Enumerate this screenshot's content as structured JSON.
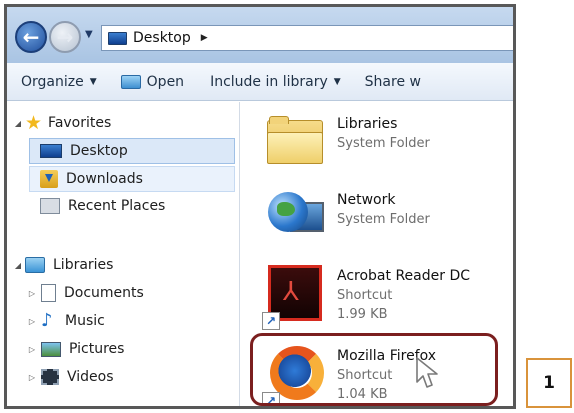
{
  "address_bar": {
    "location": "Desktop"
  },
  "toolbar": {
    "organize": "Organize",
    "open": "Open",
    "include_in_library": "Include in library",
    "share": "Share w"
  },
  "nav": {
    "favorites": "Favorites",
    "desktop": "Desktop",
    "downloads": "Downloads",
    "recent_places": "Recent Places",
    "libraries": "Libraries",
    "documents": "Documents",
    "music": "Music",
    "pictures": "Pictures",
    "videos": "Videos"
  },
  "files": [
    {
      "name": "Libraries",
      "type": "System Folder",
      "icon": "folder-icon"
    },
    {
      "name": "Network",
      "type": "System Folder",
      "icon": "network-globe-icon"
    },
    {
      "name": "Acrobat Reader DC",
      "type": "Shortcut",
      "size": "1.99 KB",
      "icon": "acrobat-icon"
    },
    {
      "name": "Mozilla Firefox",
      "type": "Shortcut",
      "size": "1.04 KB",
      "icon": "firefox-icon"
    }
  ],
  "callout": {
    "step": "1",
    "highlight_color": "#7b1f1f",
    "badge_border_color": "#d9933b"
  },
  "colors": {
    "selection": "#dbe8f8",
    "toolbar_text": "#1f3146"
  }
}
